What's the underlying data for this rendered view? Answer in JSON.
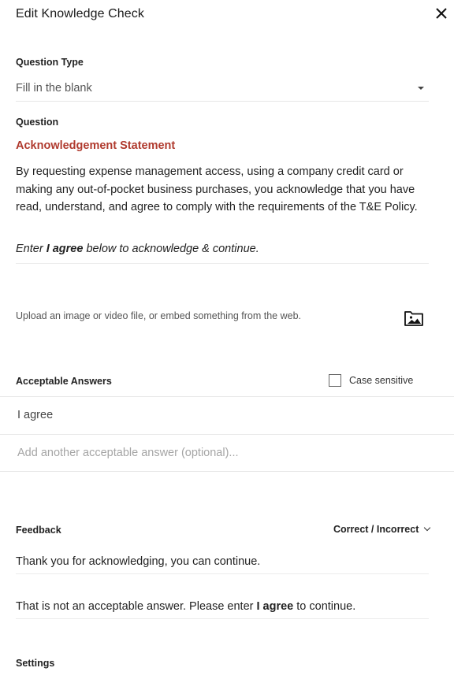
{
  "dialog": {
    "title": "Edit Knowledge Check"
  },
  "question_type": {
    "label": "Question Type",
    "value": "Fill in the blank"
  },
  "question": {
    "label": "Question",
    "title": "Acknowledgement Statement",
    "body": "By requesting expense management access, using a company credit card or making any out-of-pocket business purchases, you acknowledge that you have read, understand, and agree to comply with the requirements of the T&E Policy.",
    "instruction_prefix": "Enter ",
    "instruction_bold": "I agree",
    "instruction_suffix": " below to acknowledge & continue."
  },
  "media": {
    "prompt": "Upload an image or video file, or embed something from the web."
  },
  "answers": {
    "label": "Acceptable Answers",
    "case_sensitive_label": "Case sensitive",
    "case_sensitive_checked": false,
    "items": [
      "I agree"
    ],
    "add_placeholder": "Add another acceptable answer (optional)..."
  },
  "feedback": {
    "label": "Feedback",
    "mode_label": "Correct / Incorrect",
    "correct": "Thank you for acknowledging, you can continue.",
    "incorrect_prefix": "That is not an acceptable answer. Please enter ",
    "incorrect_bold": "I agree",
    "incorrect_suffix": " to continue."
  },
  "settings": {
    "label": "Settings"
  },
  "colors": {
    "accent": "#b03a2e"
  },
  "icons": {
    "close": "close-icon",
    "caret": "caret-down-icon",
    "media": "image-folder-icon",
    "chevron": "chevron-down-icon"
  }
}
